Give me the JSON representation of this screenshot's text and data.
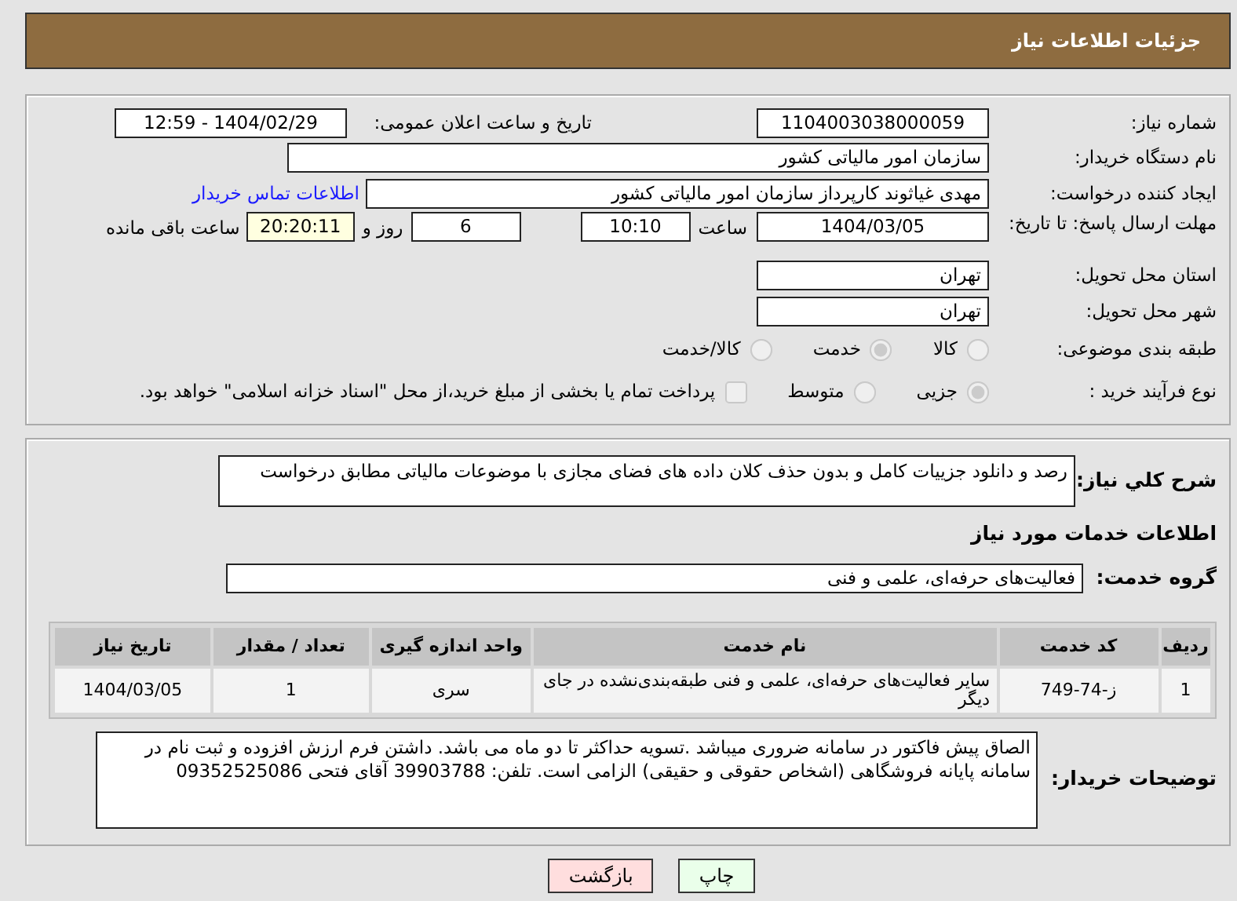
{
  "header": {
    "title": "جزئیات اطلاعات نیاز"
  },
  "need_number": {
    "label": "شماره نیاز:",
    "value": "1104003038000059"
  },
  "announce": {
    "label": "تاریخ و ساعت اعلان عمومی:",
    "value": "1404/02/29 - 12:59"
  },
  "buyer_org": {
    "label": "نام دستگاه خریدار:",
    "value": "سازمان امور مالیاتی کشور"
  },
  "creator": {
    "label": "ایجاد کننده درخواست:",
    "value": "مهدی غیاثوند کارپرداز سازمان امور مالیاتی کشور",
    "link": "اطلاعات تماس خریدار"
  },
  "deadline": {
    "label": "مهلت ارسال پاسخ: تا تاریخ:",
    "date": "1404/03/05",
    "time_label": "ساعت",
    "time": "10:10",
    "days": "6",
    "days_label": "روز و",
    "remaining": "20:20:11",
    "remaining_label": "ساعت باقی مانده"
  },
  "province": {
    "label": "استان محل تحویل:",
    "value": "تهران"
  },
  "city": {
    "label": "شهر محل تحویل:",
    "value": "تهران"
  },
  "category": {
    "label": "طبقه بندی موضوعی:",
    "options": [
      {
        "label": "کالا",
        "selected": false
      },
      {
        "label": "خدمت",
        "selected": true
      },
      {
        "label": "کالا/خدمت",
        "selected": false
      }
    ]
  },
  "process": {
    "label": "نوع فرآیند خرید :",
    "options": [
      {
        "label": "جزیی",
        "selected": true
      },
      {
        "label": "متوسط",
        "selected": false
      }
    ],
    "payment": {
      "checked": false,
      "label": "پرداخت تمام یا بخشی از مبلغ خرید،از محل \"اسناد خزانه اسلامی\" خواهد بود."
    }
  },
  "description": {
    "label": "شرح کلي نياز:",
    "value": "رصد و دانلود جزییات کامل و بدون حذف کلان داده های فضای مجازی با موضوعات مالیاتی مطابق درخواست"
  },
  "services_heading": "اطلاعات خدمات مورد نیاز",
  "service_group": {
    "label": "گروه خدمت:",
    "value": "فعالیت‌های حرفه‌ای، علمی و فنی"
  },
  "table": {
    "columns": [
      "ردیف",
      "کد خدمت",
      "نام خدمت",
      "واحد اندازه گیری",
      "تعداد / مقدار",
      "تاریخ نیاز"
    ],
    "rows": [
      [
        "1",
        "ز-74-749",
        "سایر فعالیت‌های حرفه‌ای، علمی و فنی طبقه‌بندی‌نشده در جای دیگر",
        "سری",
        "1",
        "1404/03/05"
      ]
    ]
  },
  "buyer_notes": {
    "label": "توضیحات خریدار:",
    "value": "الصاق پیش فاکتور در سامانه ضروری میباشد .تسویه حداکثر تا دو ماه می باشد.  داشتن فرم ارزش افزوده و ثبت نام در سامانه پایانه فروشگاهی (اشخاص حقوقی و حقیقی) الزامی است. تلفن:  39903788 آقای فتحی 09352525086"
  },
  "buttons": [
    {
      "label": "چاپ",
      "kind": "print"
    },
    {
      "label": "بازگشت",
      "kind": "back"
    }
  ]
}
